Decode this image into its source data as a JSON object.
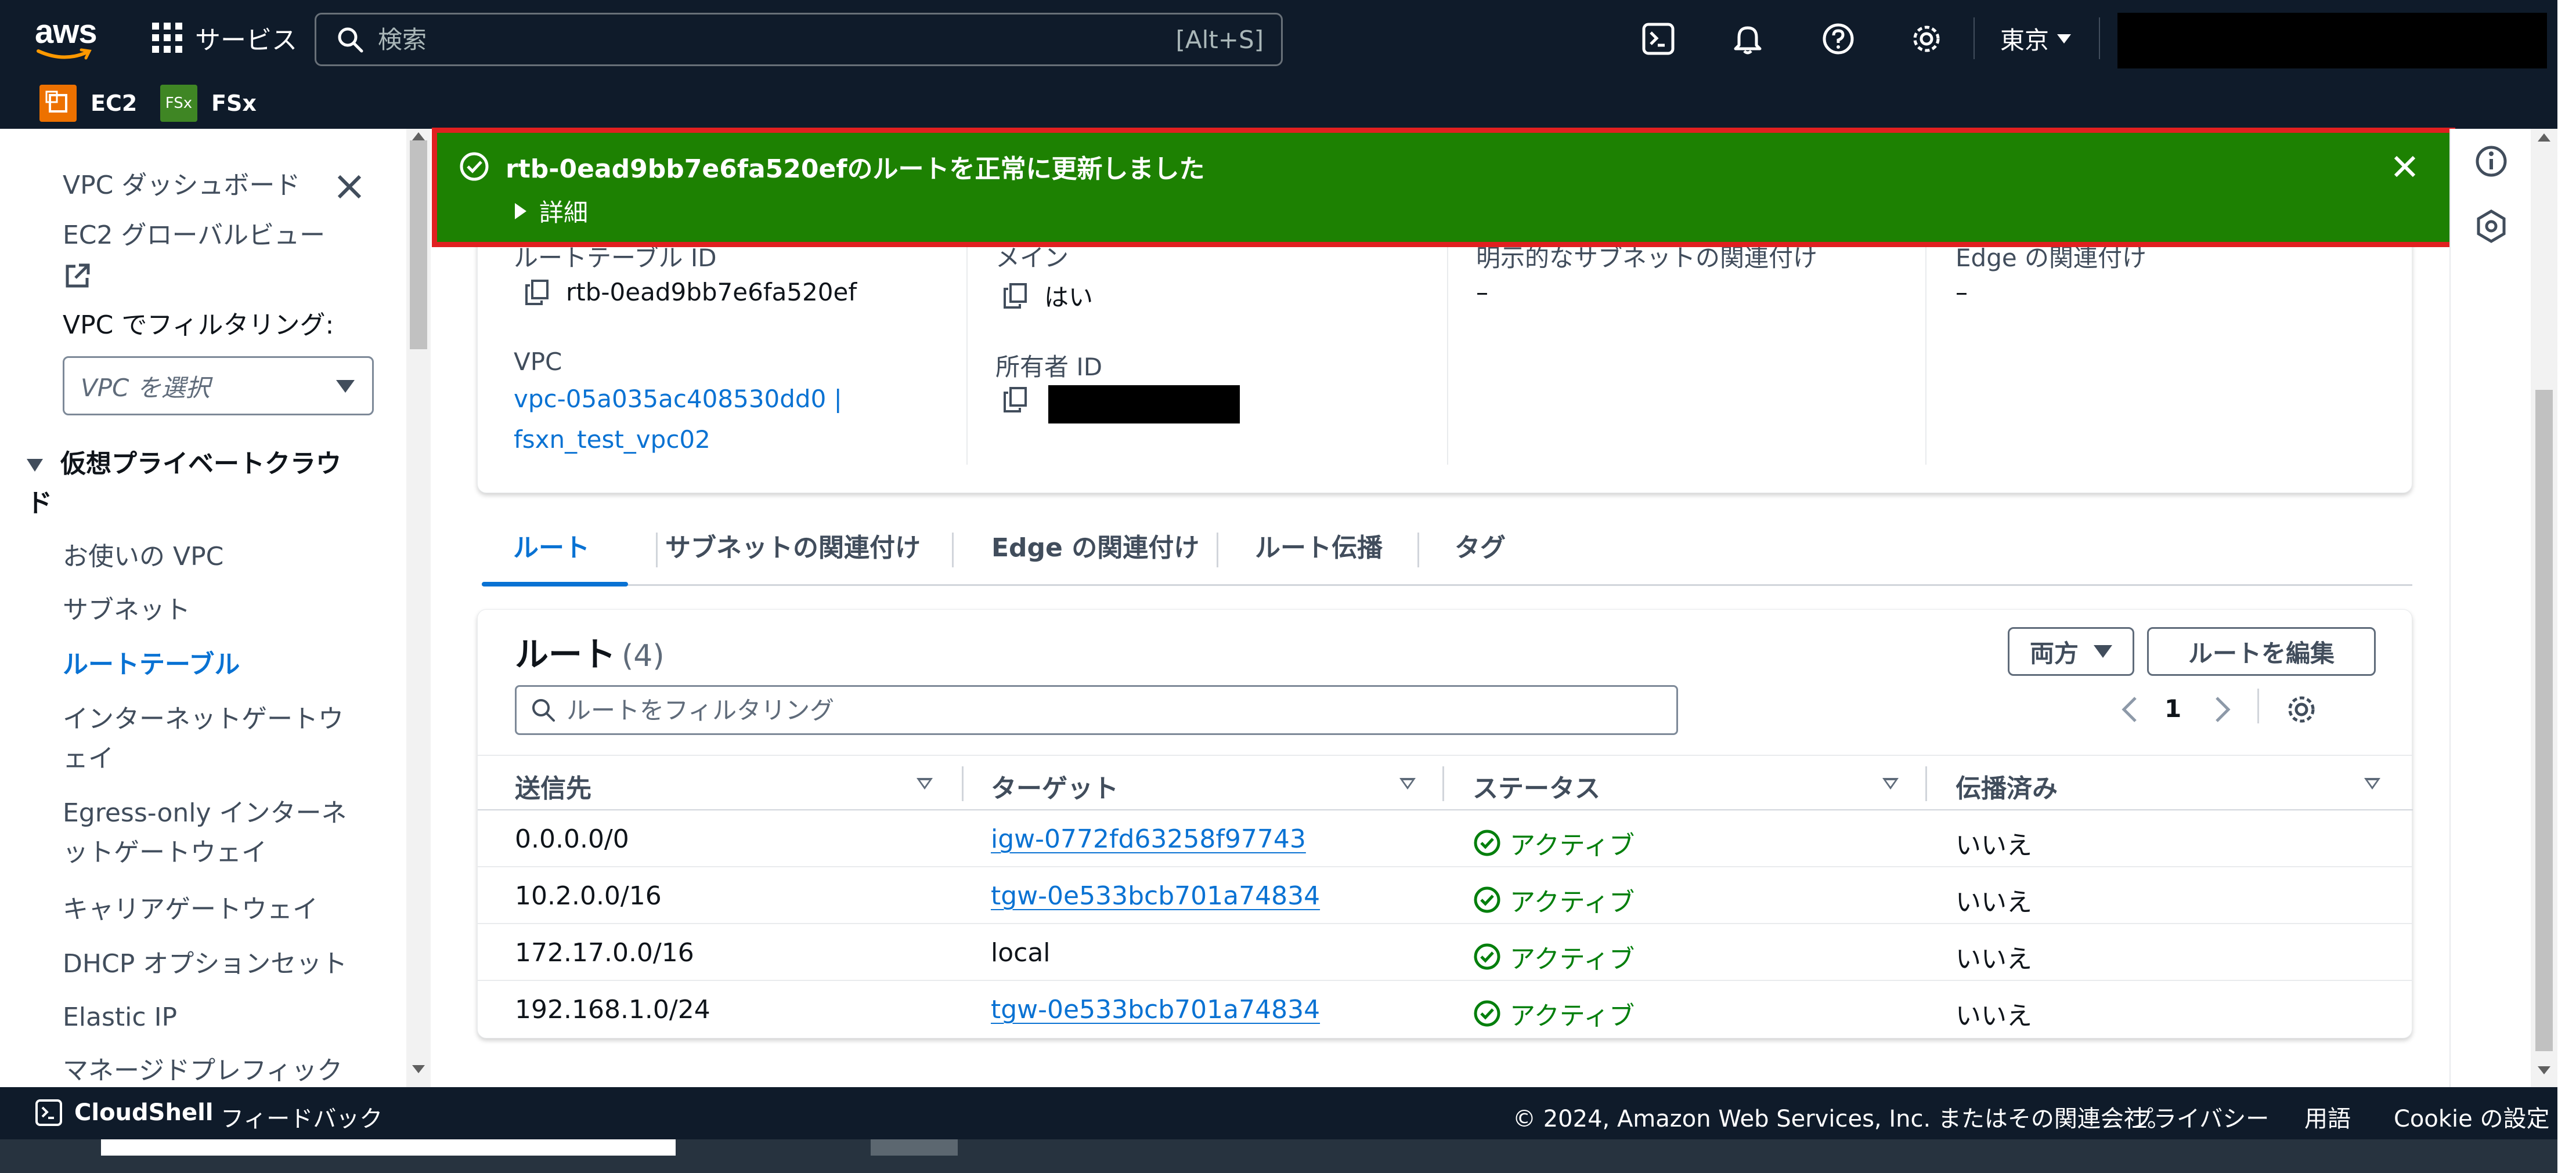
{
  "topnav": {
    "logo_text": "aws",
    "services_label": "サービス",
    "search_placeholder": "検索",
    "search_shortcut": "[Alt+S]",
    "region": "東京"
  },
  "favorites": [
    {
      "label": "EC2",
      "icon": "ec2-icon",
      "color": "#ed7100"
    },
    {
      "label": "FSx",
      "icon": "fsx-icon",
      "color": "#3f8624",
      "icon_text": "FSx"
    }
  ],
  "sidebar": {
    "dashboard": "VPC ダッシュボード",
    "global_view_line1": "EC2 グローバルビュー",
    "filter_label": "VPC でフィルタリング:",
    "filter_placeholder": "VPC を選択",
    "section_title_line1": "仮想プライベートクラウ",
    "section_title_line2": "ド",
    "items": [
      {
        "label": "お使いの VPC"
      },
      {
        "label": "サブネット"
      },
      {
        "label": "ルートテーブル",
        "active": true
      },
      {
        "label_line1": "インターネットゲートウ",
        "label_line2": "ェイ"
      },
      {
        "label_line1": "Egress-only インターネ",
        "label_line2": "ットゲートウェイ"
      },
      {
        "label": "キャリアゲートウェイ"
      },
      {
        "label": "DHCP オプションセット"
      },
      {
        "label": "Elastic IP"
      },
      {
        "label": "マネージドプレフィック"
      }
    ]
  },
  "flash": {
    "message": "rtb-0ead9bb7e6fa520efのルートを正常に更新しました",
    "detail_label": "詳細",
    "type": "success",
    "color": "#1d8102"
  },
  "details": {
    "route_table_id_label": "ルートテーブル ID",
    "route_table_id_value": "rtb-0ead9bb7e6fa520ef",
    "main_label": "メイン",
    "main_value": "はい",
    "explicit_subnet_label": "明示的なサブネットの関連付け",
    "explicit_subnet_value": "–",
    "edge_assoc_label": "Edge の関連付け",
    "edge_assoc_value": "–",
    "vpc_label": "VPC",
    "vpc_link_line1": "vpc-05a035ac408530dd0 |",
    "vpc_link_line2": "fsxn_test_vpc02",
    "owner_id_label": "所有者 ID"
  },
  "tabs": [
    {
      "label": "ルート",
      "active": true
    },
    {
      "label": "サブネットの関連付け"
    },
    {
      "label": "Edge の関連付け"
    },
    {
      "label": "ルート伝播"
    },
    {
      "label": "タグ"
    }
  ],
  "routes": {
    "title": "ルート",
    "count": "(4)",
    "both_label": "両方",
    "edit_button": "ルートを編集",
    "filter_placeholder": "ルートをフィルタリング",
    "page": "1",
    "columns": [
      "送信先",
      "ターゲット",
      "ステータス",
      "伝播済み"
    ],
    "rows": [
      {
        "destination": "0.0.0.0/0",
        "target": "igw-0772fd63258f97743",
        "target_link": true,
        "status": "アクティブ",
        "propagated": "いいえ"
      },
      {
        "destination": "10.2.0.0/16",
        "target": "tgw-0e533bcb701a74834",
        "target_link": true,
        "status": "アクティブ",
        "propagated": "いいえ"
      },
      {
        "destination": "172.17.0.0/16",
        "target": "local",
        "target_link": false,
        "status": "アクティブ",
        "propagated": "いいえ"
      },
      {
        "destination": "192.168.1.0/24",
        "target": "tgw-0e533bcb701a74834",
        "target_link": true,
        "status": "アクティブ",
        "propagated": "いいえ"
      }
    ]
  },
  "footer": {
    "cloudshell": "CloudShell",
    "feedback": "フィードバック",
    "copyright": "© 2024, Amazon Web Services, Inc. またはその関連会社。",
    "privacy": "プライバシー",
    "terms": "用語",
    "cookie": "Cookie の設定"
  },
  "colors": {
    "nav_bg": "#0f1b2a",
    "link": "#0972d3",
    "success": "#037f0c",
    "highlight_border": "#e02020"
  }
}
